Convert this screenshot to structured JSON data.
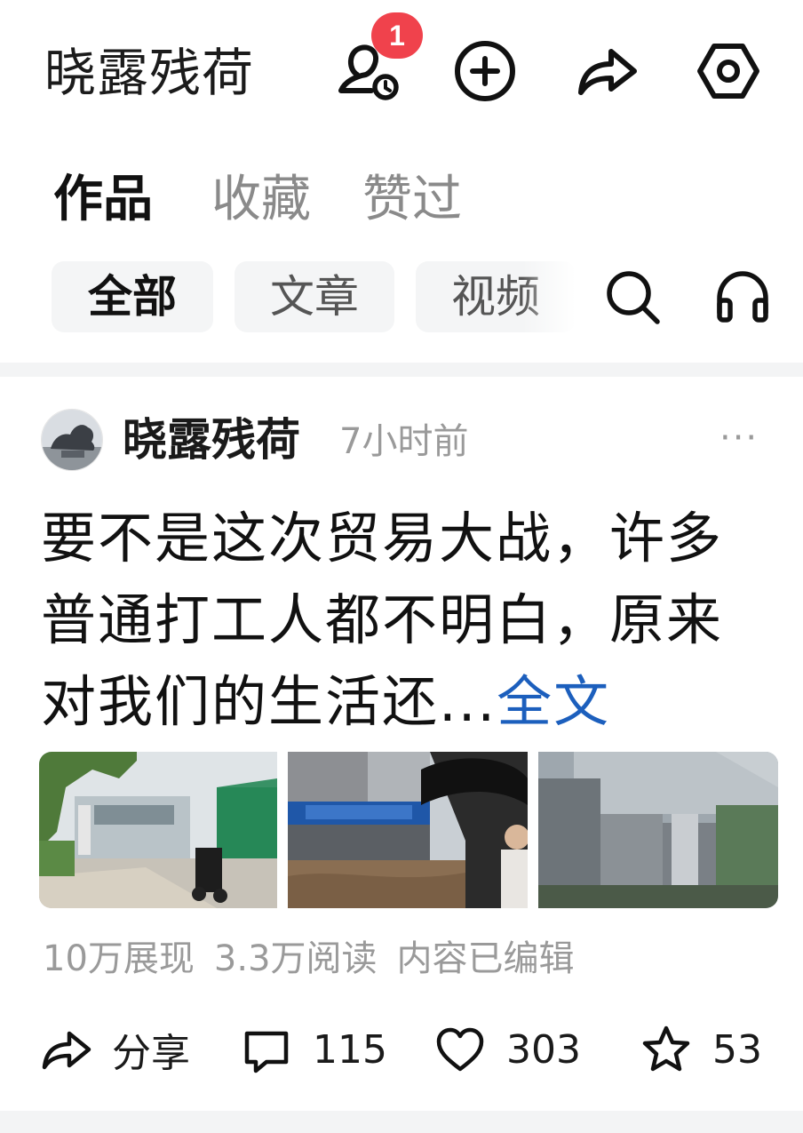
{
  "header": {
    "title": "晓露残荷",
    "badge_count": "1",
    "icons": [
      "visitor-history-icon",
      "add-icon",
      "share-icon",
      "settings-icon"
    ]
  },
  "tabs": [
    "作品",
    "收藏",
    "赞过"
  ],
  "filters": [
    "全部",
    "文章",
    "视频"
  ],
  "filter_icons": [
    "search-icon",
    "headphones-icon"
  ],
  "post": {
    "author": "晓露残荷",
    "time": "7小时前",
    "more": "···",
    "text": "要不是这次贸易大战，许多普通打工人都不明白，原来对我们的生活还...",
    "full_link": "全文",
    "images": [
      "school-gate-photo",
      "flooded-street-photo",
      "buildings-photo"
    ],
    "stats": {
      "views": "10万展现",
      "reads": "3.3万阅读",
      "edited": "内容已编辑"
    },
    "actions": {
      "share": "分享",
      "comments": "115",
      "likes": "303",
      "favorites": "53"
    }
  },
  "colors": {
    "badge": "#f0424c",
    "link": "#1c5fbd",
    "muted": "#9a9a9a",
    "chip_bg": "#f4f5f6"
  }
}
